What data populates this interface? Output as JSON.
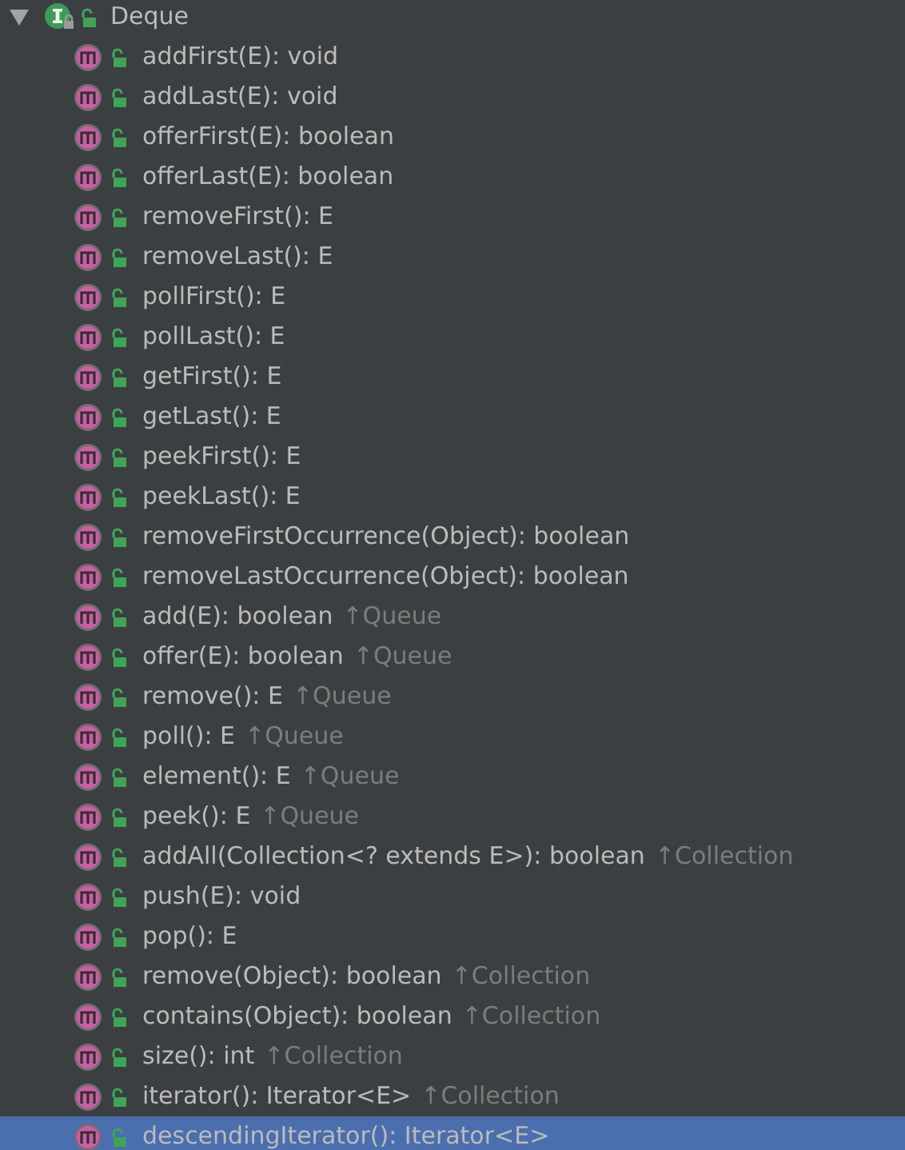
{
  "root": {
    "label": "Deque",
    "expanded": true,
    "selected": false,
    "children": [
      {
        "label": "addFirst(E): void",
        "selected": false
      },
      {
        "label": "addLast(E): void",
        "selected": false
      },
      {
        "label": "offerFirst(E): boolean",
        "selected": false
      },
      {
        "label": "offerLast(E): boolean",
        "selected": false
      },
      {
        "label": "removeFirst(): E",
        "selected": false
      },
      {
        "label": "removeLast(): E",
        "selected": false
      },
      {
        "label": "pollFirst(): E",
        "selected": false
      },
      {
        "label": "pollLast(): E",
        "selected": false
      },
      {
        "label": "getFirst(): E",
        "selected": false
      },
      {
        "label": "getLast(): E",
        "selected": false
      },
      {
        "label": "peekFirst(): E",
        "selected": false
      },
      {
        "label": "peekLast(): E",
        "selected": false
      },
      {
        "label": "removeFirstOccurrence(Object): boolean",
        "selected": false
      },
      {
        "label": "removeLastOccurrence(Object): boolean",
        "selected": false
      },
      {
        "label": "add(E): boolean",
        "inherited": "↑Queue",
        "selected": false
      },
      {
        "label": "offer(E): boolean",
        "inherited": "↑Queue",
        "selected": false
      },
      {
        "label": "remove(): E",
        "inherited": "↑Queue",
        "selected": false
      },
      {
        "label": "poll(): E",
        "inherited": "↑Queue",
        "selected": false
      },
      {
        "label": "element(): E",
        "inherited": "↑Queue",
        "selected": false
      },
      {
        "label": "peek(): E",
        "inherited": "↑Queue",
        "selected": false
      },
      {
        "label": "addAll(Collection<? extends E>): boolean",
        "inherited": "↑Collection",
        "selected": false
      },
      {
        "label": "push(E): void",
        "selected": false
      },
      {
        "label": "pop(): E",
        "selected": false
      },
      {
        "label": "remove(Object): boolean",
        "inherited": "↑Collection",
        "selected": false
      },
      {
        "label": "contains(Object): boolean",
        "inherited": "↑Collection",
        "selected": false
      },
      {
        "label": "size(): int",
        "inherited": "↑Collection",
        "selected": false
      },
      {
        "label": "iterator(): Iterator<E>",
        "inherited": "↑Collection",
        "selected": false
      },
      {
        "label": "descendingIterator(): Iterator<E>",
        "selected": true
      }
    ]
  }
}
